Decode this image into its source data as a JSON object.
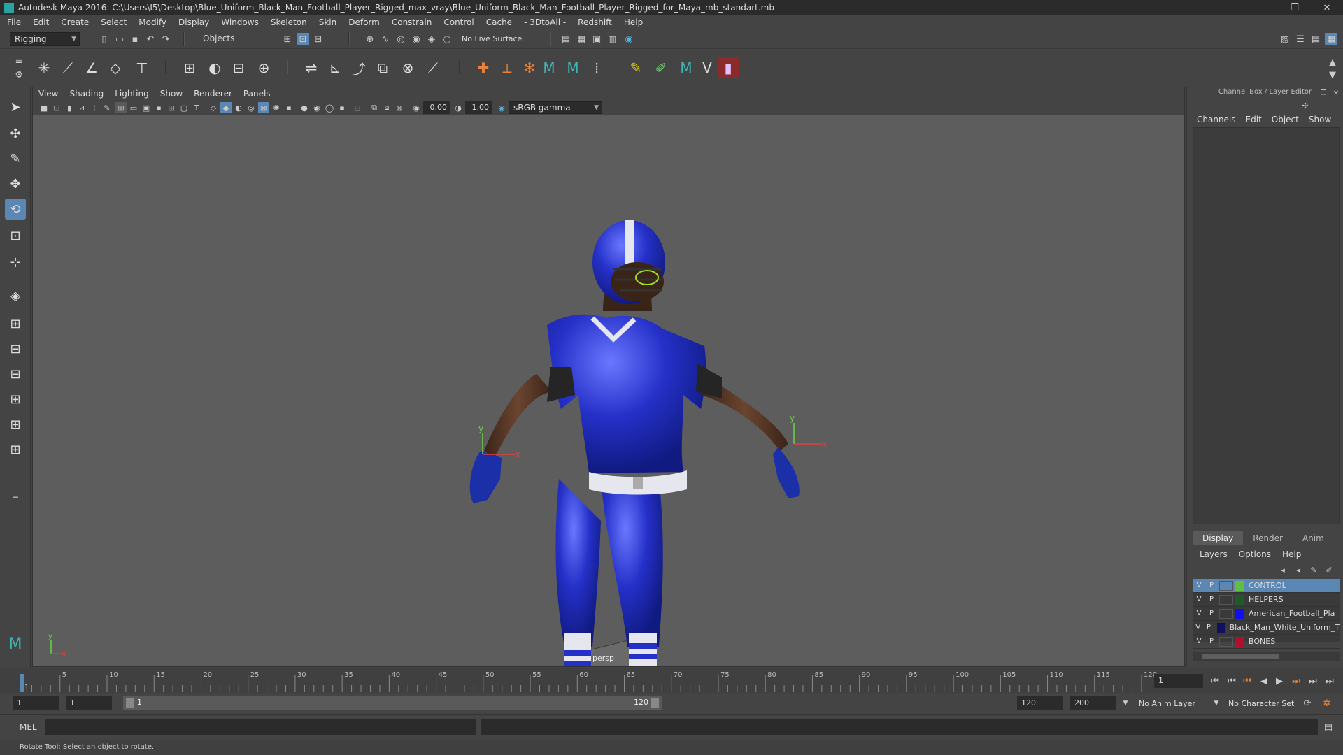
{
  "window": {
    "title": "Autodesk Maya 2016: C:\\Users\\I5\\Desktop\\Blue_Uniform_Black_Man_Football_Player_Rigged_max_vray\\Blue_Uniform_Black_Man_Football_Player_Rigged_for_Maya_mb_standart.mb",
    "controls": [
      "—",
      "❐",
      "✕"
    ]
  },
  "menubar": [
    "File",
    "Edit",
    "Create",
    "Select",
    "Modify",
    "Display",
    "Windows",
    "Skeleton",
    "Skin",
    "Deform",
    "Constrain",
    "Control",
    "Cache",
    "- 3DtoAll -",
    "Redshift",
    "Help"
  ],
  "statusline": {
    "menuset": "Rigging",
    "selection_mode": "Objects",
    "live_surface": "No Live Surface"
  },
  "panel": {
    "menu": [
      "View",
      "Shading",
      "Lighting",
      "Show",
      "Renderer",
      "Panels"
    ],
    "exposure": "0.00",
    "gamma": "1.00",
    "color_space": "sRGB gamma",
    "camera_label": "persp"
  },
  "channelbox": {
    "title": "Channel Box / Layer Editor",
    "menu": [
      "Channels",
      "Edit",
      "Object",
      "Show"
    ]
  },
  "layer_editor": {
    "tabs": [
      "Display",
      "Render",
      "Anim"
    ],
    "menu": [
      "Layers",
      "Options",
      "Help"
    ],
    "layers": [
      {
        "v": "V",
        "p": "P",
        "name": "CONTROL",
        "color": "#5fbf3f",
        "selected": true
      },
      {
        "v": "V",
        "p": "P",
        "name": "HELPERS",
        "color": "#1e5a2a",
        "selected": false
      },
      {
        "v": "V",
        "p": "P",
        "name": "American_Football_Pla",
        "color": "#1010ee",
        "selected": false
      },
      {
        "v": "V",
        "p": "P",
        "name": "Black_Man_White_Uniform_T",
        "color": "#101060",
        "selected": false
      },
      {
        "v": "V",
        "p": "P",
        "name": "BONES",
        "color": "#b01030",
        "selected": false
      }
    ]
  },
  "timeslider": {
    "ticks": [
      "1",
      "5",
      "10",
      "15",
      "20",
      "25",
      "30",
      "35",
      "40",
      "45",
      "50",
      "55",
      "60",
      "65",
      "70",
      "75",
      "80",
      "85",
      "90",
      "95",
      "100",
      "105",
      "110",
      "115",
      "120"
    ],
    "current_frame": "1"
  },
  "rangeslider": {
    "start": "1",
    "playback_start": "1",
    "range_start_label": "1",
    "range_end_label": "120",
    "playback_end": "120",
    "end": "200",
    "anim_layer": "No Anim Layer",
    "character_set": "No Character Set"
  },
  "cmdline": {
    "label": "MEL"
  },
  "helpline": "Rotate Tool: Select an object to rotate."
}
